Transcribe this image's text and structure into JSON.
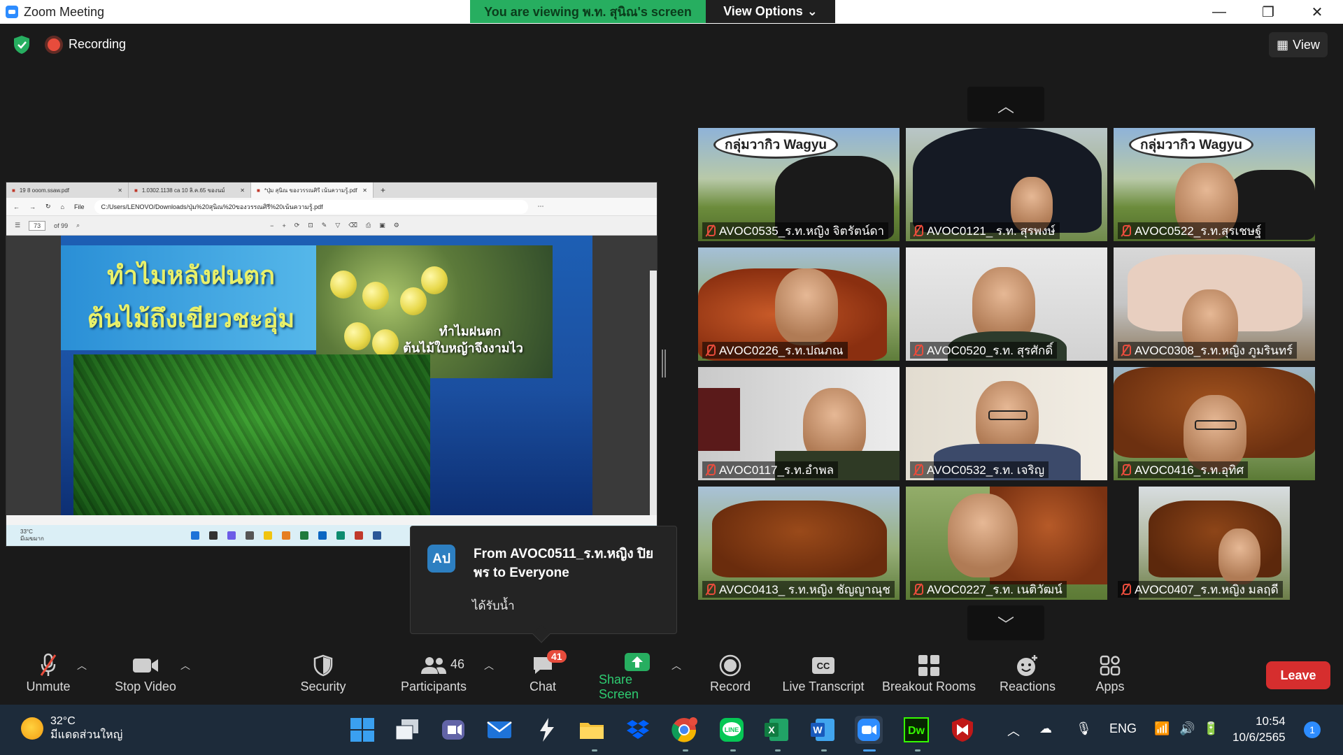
{
  "window": {
    "title": "Zoom Meeting",
    "viewing_banner": "You are viewing พ.ท. สุนิณ's screen",
    "view_options": "View Options"
  },
  "meeting": {
    "recording_label": "Recording",
    "view_label": "View"
  },
  "shared_screen": {
    "tabs": [
      "19 8 ooom.ssaw.pdf",
      "1.0302.1138 ca 10 ลิ.ค.65 ของนม์",
      "*ปุ่ม สุนิณ ของวรรณศิรี เน้นความรู้.pdf"
    ],
    "address_label": "File",
    "url": "C:/Users/LENOVO/Downloads/ปุ่ม%20สุนิณ%20ของวรรณศิรี%20เน้นความรู้.pdf",
    "page_number": "73",
    "page_total": "of 99",
    "slide_title_line1": "ทำไมหลังฝนตก",
    "slide_title_line2": "ต้นไม้ถึงเขียวชะอุ่ม",
    "slide_sub_line1": "ทำไมฝนตก",
    "slide_sub_line2": "ต้นไม้ใบหญ้าจึงงามไว",
    "mini_weather_temp": "33°C",
    "mini_weather_desc": "มีเมฆมาก"
  },
  "gallery": {
    "tiles": [
      {
        "name": "AVOC0535_ร.ท.หญิง จิตรัตน์ดา",
        "overlay": "กลุ่มวากิว Wagyu"
      },
      {
        "name": "AVOC0121_ ร.ท. สุรพงษ์",
        "overlay": ""
      },
      {
        "name": "AVOC0522_ร.ท.สุรเชษฐ์",
        "overlay": "กลุ่มวากิว Wagyu"
      },
      {
        "name": "AVOC0226_ร.ท.ปณภณ",
        "overlay": ""
      },
      {
        "name": "AVOC0520_ร.ท. สุรศักดิ์",
        "overlay": ""
      },
      {
        "name": "AVOC0308_ร.ท.หญิง ภูมรินทร์",
        "overlay": ""
      },
      {
        "name": "AVOC0117_ร.ท.อำพล",
        "overlay": ""
      },
      {
        "name": "AVOC0532_ร.ท. เจริญ",
        "overlay": ""
      },
      {
        "name": "AVOC0416_ร.ท.อุทิศ",
        "overlay": ""
      },
      {
        "name": "AVOC0413_ ร.ท.หญิง ชัญญาณุช",
        "overlay": ""
      },
      {
        "name": "AVOC0227_ร.ท. เนติวัฒน์",
        "overlay": ""
      },
      {
        "name": "AVOC0407_ร.ท.หญิง มลฤดี",
        "overlay": ""
      }
    ]
  },
  "chat_popup": {
    "avatar_initials": "Aป",
    "from": "From AVOC0511_ร.ท.หญิง ปิยพร to Everyone",
    "message": "ได้รับน้ำ"
  },
  "toolbar": {
    "unmute": "Unmute",
    "stop_video": "Stop Video",
    "security": "Security",
    "participants": "Participants",
    "participants_count": "46",
    "chat": "Chat",
    "chat_badge": "41",
    "share_screen": "Share Screen",
    "record": "Record",
    "live_transcript": "Live Transcript",
    "breakout_rooms": "Breakout Rooms",
    "reactions": "Reactions",
    "apps": "Apps",
    "leave": "Leave"
  },
  "taskbar": {
    "weather_temp": "32°C",
    "weather_desc": "มีแดดส่วนใหญ่",
    "language": "ENG",
    "time": "10:54",
    "date": "10/6/2565",
    "notifications": "1"
  },
  "colors": {
    "zoom_blue": "#2d8cff",
    "banner_green": "#27ae60",
    "leave_red": "#d62e2e",
    "share_green": "#2ecc71"
  }
}
